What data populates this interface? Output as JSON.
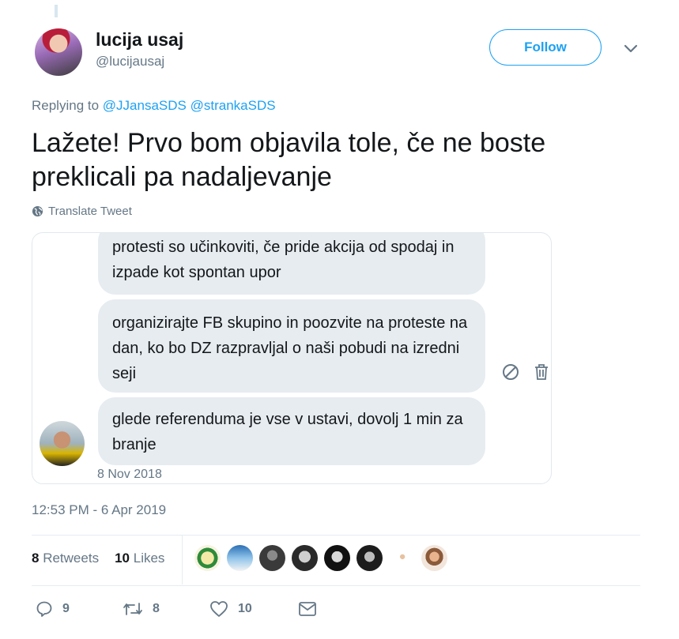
{
  "user": {
    "display_name": "lucija usaj",
    "handle": "@lucijausaj"
  },
  "follow": {
    "label": "Follow"
  },
  "replying": {
    "prefix": "Replying to",
    "mentions": [
      "@JJansaSDS",
      "@strankaSDS"
    ]
  },
  "tweet": {
    "text": "Lažete! Prvo bom objavila tole, če ne boste preklicali pa nadaljevanje",
    "translate_label": "Translate Tweet"
  },
  "media": {
    "messages": [
      "protesti so učinkoviti, če pride akcija od spodaj in izpade kot spontan upor",
      "organizirajte FB skupino in poozvite na proteste na dan, ko bo DZ razpravljal o naši pobudi na izredni seji",
      "glede referenduma je vse v ustavi, dovolj 1 min za branje"
    ],
    "date": "8 Nov 2018"
  },
  "timestamp": "12:53 PM - 6 Apr 2019",
  "stats": {
    "retweets_count": "8",
    "retweets_label": "Retweets",
    "likes_count": "10",
    "likes_label": "Likes"
  },
  "actions": {
    "reply_count": "9",
    "retweet_count": "8",
    "like_count": "10"
  },
  "colors": {
    "accent": "#1da1f2",
    "secondary_text": "#657786",
    "bubble": "#e6ecf0"
  }
}
